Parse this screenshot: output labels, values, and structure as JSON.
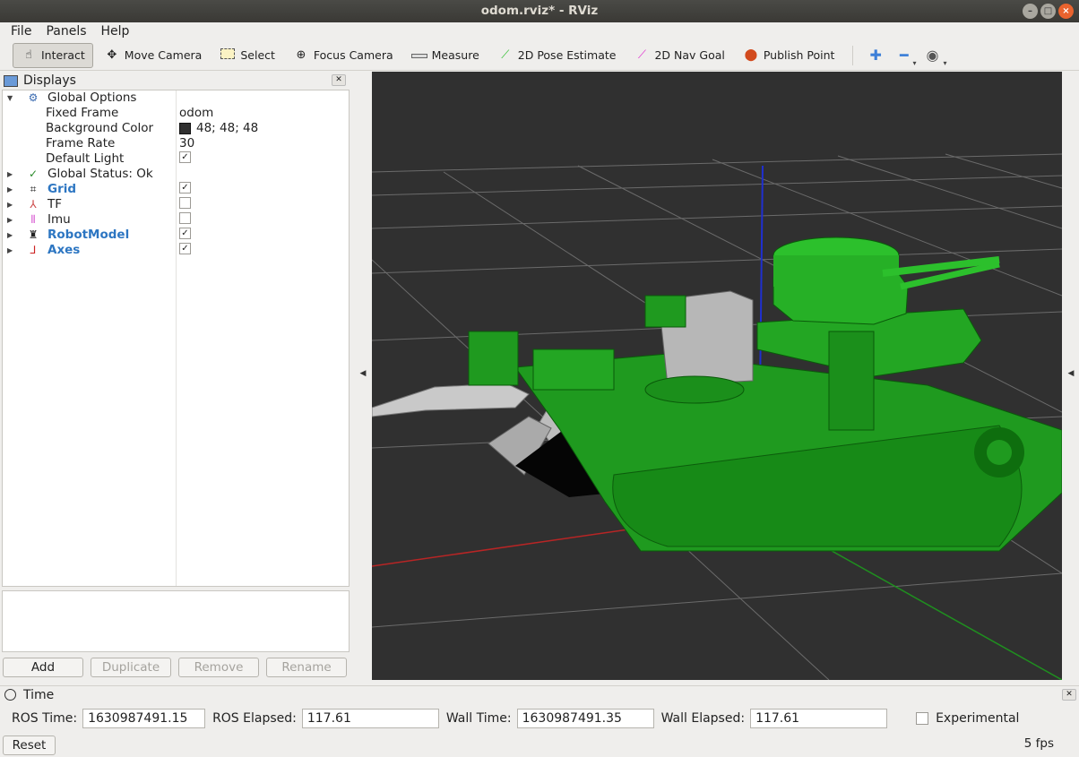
{
  "window": {
    "title": "odom.rviz* - RViz"
  },
  "menu": [
    "File",
    "Panels",
    "Help"
  ],
  "toolbar": {
    "tools": [
      {
        "label": "Interact",
        "icon": "hand-icon"
      },
      {
        "label": "Move Camera",
        "icon": "move-camera-icon"
      },
      {
        "label": "Select",
        "icon": "select-icon"
      },
      {
        "label": "Focus Camera",
        "icon": "focus-camera-icon"
      },
      {
        "label": "Measure",
        "icon": "ruler-icon"
      },
      {
        "label": "2D Pose Estimate",
        "icon": "pose-arrow-icon",
        "color": "#2fbf2f"
      },
      {
        "label": "2D Nav Goal",
        "icon": "nav-arrow-icon",
        "color": "#e02fd0"
      },
      {
        "label": "Publish Point",
        "icon": "map-pin-icon",
        "color": "#d24a1d"
      }
    ]
  },
  "displays": {
    "title": "Displays",
    "global_options": {
      "label": "Global Options",
      "fixed_frame_label": "Fixed Frame",
      "fixed_frame_value": "odom",
      "background_color_label": "Background Color",
      "background_color_value": "48; 48; 48",
      "frame_rate_label": "Frame Rate",
      "frame_rate_value": "30",
      "default_light_label": "Default Light"
    },
    "global_status": "Global Status: Ok",
    "items": [
      {
        "label": "Grid",
        "checked": true
      },
      {
        "label": "TF",
        "checked": false
      },
      {
        "label": "Imu",
        "checked": false
      },
      {
        "label": "RobotModel",
        "checked": true
      },
      {
        "label": "Axes",
        "checked": true
      }
    ],
    "buttons": {
      "add": "Add",
      "duplicate": "Duplicate",
      "remove": "Remove",
      "rename": "Rename"
    }
  },
  "time": {
    "title": "Time",
    "ros_time_label": "ROS Time:",
    "ros_time": "1630987491.15",
    "ros_elapsed_label": "ROS Elapsed:",
    "ros_elapsed": "117.61",
    "wall_time_label": "Wall Time:",
    "wall_time": "1630987491.35",
    "wall_elapsed_label": "Wall Elapsed:",
    "wall_elapsed": "117.61",
    "experimental_label": "Experimental",
    "reset_label": "Reset",
    "fps": "5 fps"
  },
  "colors": {
    "viewport_bg": "#303030",
    "robot": "#1f9a1f",
    "link_blue": "#2d76c2"
  }
}
